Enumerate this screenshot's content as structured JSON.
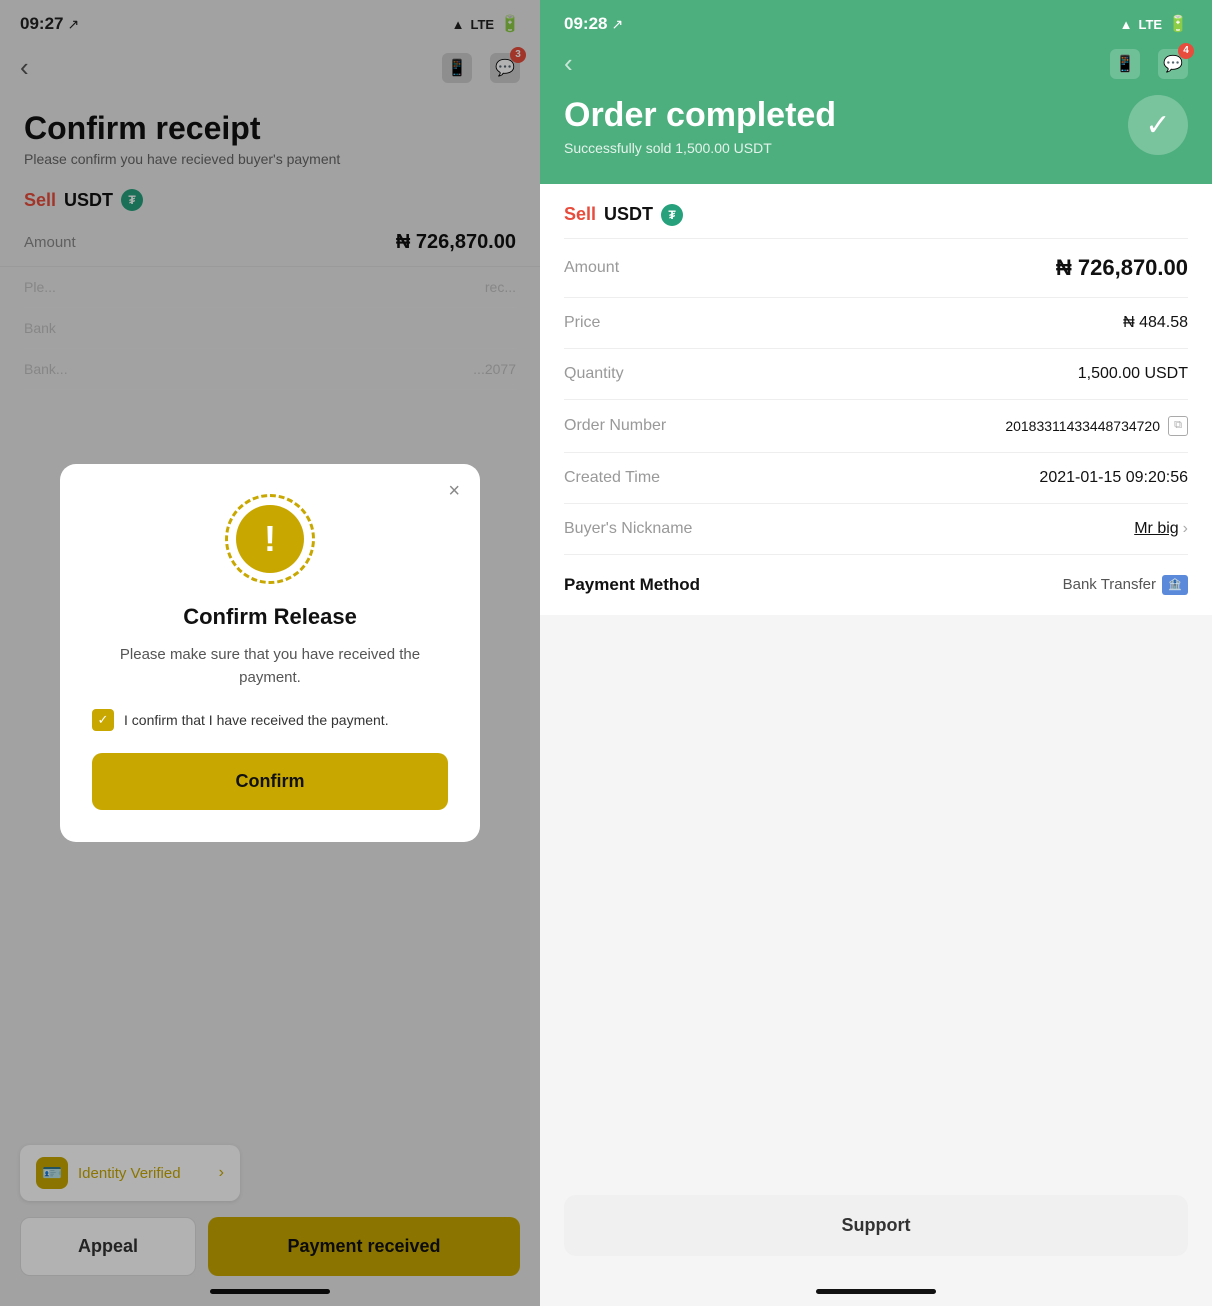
{
  "left": {
    "statusBar": {
      "time": "09:27",
      "locationIcon": "↗",
      "signal": "▲",
      "lte": "LTE",
      "battery": "🔋"
    },
    "nav": {
      "backLabel": "‹",
      "phoneIconBadge": "",
      "chatIconBadge": "3"
    },
    "pageTitle": "Confirm receipt",
    "pageSubtitle": "Please confirm you have recieved buyer's payment",
    "sellLabel": "Sell",
    "usdtLabel": "USDT",
    "amountLabel": "Amount",
    "amountValue": "₦ 726,870.00",
    "identityVerified": "Identity Verified",
    "buttons": {
      "appeal": "Appeal",
      "paymentReceived": "Payment received"
    },
    "modal": {
      "title": "Confirm Release",
      "description": "Please make sure that you have received the payment.",
      "checkboxLabel": "I confirm that I have received the payment.",
      "confirmBtn": "Confirm",
      "closeLabel": "×"
    }
  },
  "right": {
    "statusBar": {
      "time": "09:28",
      "locationIcon": "↗",
      "signal": "▲",
      "lte": "LTE",
      "battery": "🔋"
    },
    "nav": {
      "backLabel": "‹",
      "chatIconBadge": "4"
    },
    "header": {
      "title": "Order completed",
      "subtitle": "Successfully sold 1,500.00 USDT",
      "checkIcon": "✓"
    },
    "sellLabel": "Sell",
    "usdtLabel": "USDT",
    "rows": [
      {
        "label": "Amount",
        "value": "₦ 726,870.00",
        "large": true
      },
      {
        "label": "Price",
        "value": "₦ 484.58",
        "large": false
      },
      {
        "label": "Quantity",
        "value": "1,500.00 USDT",
        "large": false
      }
    ],
    "orderNumber": {
      "label": "Order Number",
      "value": "20183311433448734720",
      "copyIcon": "⧉"
    },
    "createdTime": {
      "label": "Created Time",
      "value": "2021-01-15 09:20:56"
    },
    "buyerNickname": {
      "label": "Buyer's Nickname",
      "value": "Mr big"
    },
    "paymentMethod": {
      "label": "Payment Method",
      "value": "Bank Transfer"
    },
    "supportBtn": "Support"
  }
}
